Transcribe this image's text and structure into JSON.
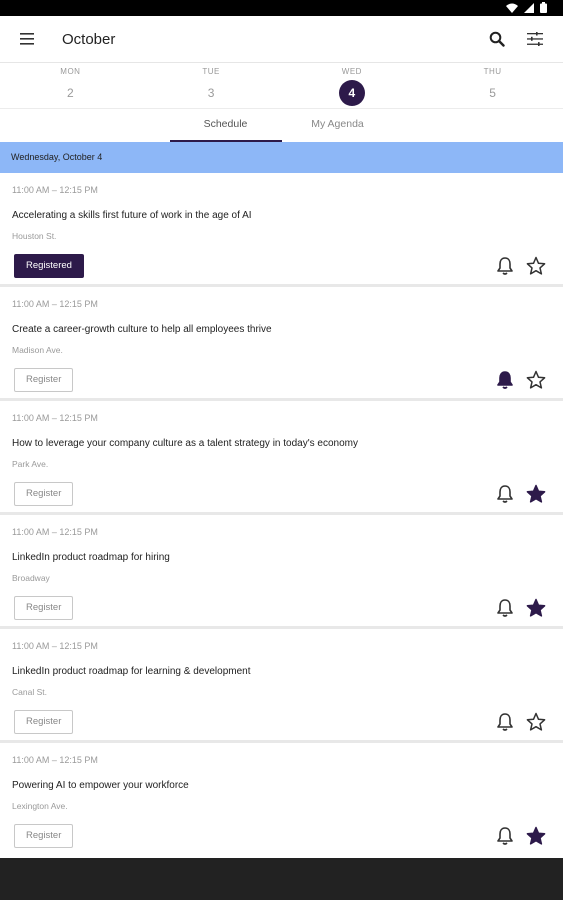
{
  "header": {
    "title": "October"
  },
  "days": [
    {
      "name": "MON",
      "num": "2"
    },
    {
      "name": "TUE",
      "num": "3"
    },
    {
      "name": "WED",
      "num": "4"
    },
    {
      "name": "THU",
      "num": "5"
    }
  ],
  "tabs": [
    {
      "label": "Schedule"
    },
    {
      "label": "My Agenda"
    }
  ],
  "date_header": "Wednesday, October 4",
  "sessions": [
    {
      "time": "11:00 AM – 12:15 PM",
      "title": "Accelerating a skills first future of work in the age of AI",
      "location": "Houston St.",
      "button": "Registered",
      "notify": false,
      "starred": false
    },
    {
      "time": "11:00 AM – 12:15 PM",
      "title": "Create a career-growth culture to help all employees thrive",
      "location": "Madison Ave.",
      "button": "Register",
      "notify": true,
      "starred": false
    },
    {
      "time": "11:00 AM – 12:15 PM",
      "title": "How to leverage your company culture as a talent strategy in today's economy",
      "location": "Park Ave.",
      "button": "Register",
      "notify": false,
      "starred": true
    },
    {
      "time": "11:00 AM – 12:15 PM",
      "title": "LinkedIn product roadmap for hiring",
      "location": "Broadway",
      "button": "Register",
      "notify": false,
      "starred": true
    },
    {
      "time": "11:00 AM – 12:15 PM",
      "title": "LinkedIn product roadmap for learning & development",
      "location": "Canal St.",
      "button": "Register",
      "notify": false,
      "starred": false
    },
    {
      "time": "11:00 AM – 12:15 PM",
      "title": "Powering AI to empower your workforce",
      "location": "Lexington Ave.",
      "button": "Register",
      "notify": false,
      "starred": true
    }
  ],
  "colors": {
    "accent": "#2d1a4a",
    "date_header": "#8db7f7"
  },
  "icons": {
    "menu": "menu-icon",
    "search": "search-icon",
    "filter": "filter-icon",
    "bell": "bell-icon",
    "star": "star-icon"
  }
}
